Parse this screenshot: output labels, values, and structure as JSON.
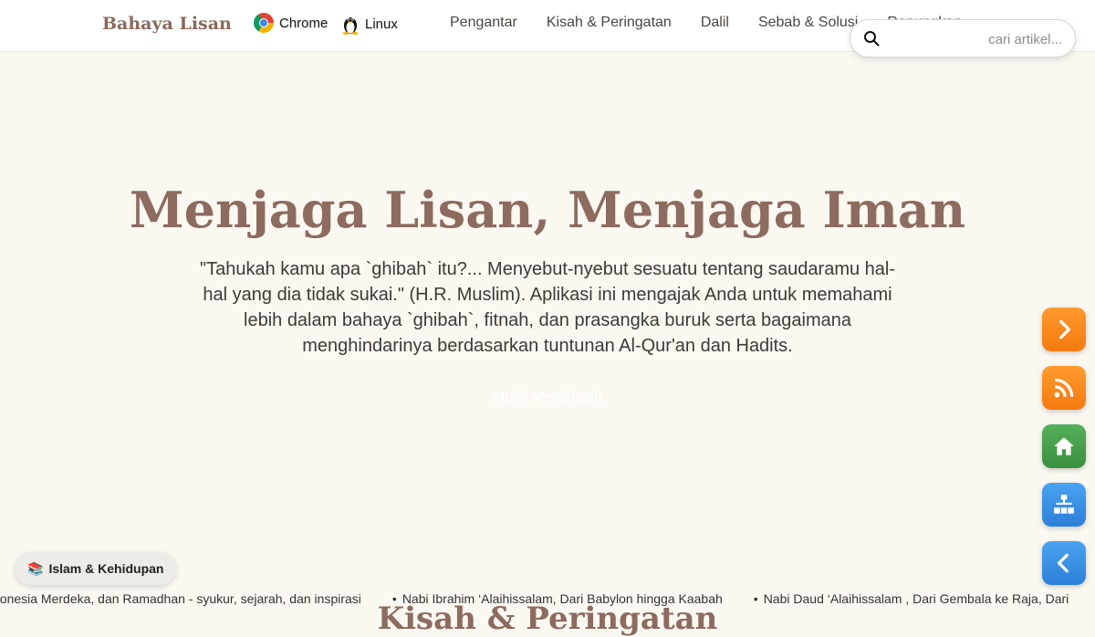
{
  "header": {
    "brand": "Bahaya Lisan",
    "env": {
      "browser": "Chrome",
      "os": "Linux"
    },
    "nav": [
      "Pengantar",
      "Kisah & Peringatan",
      "Dalil",
      "Sebab & Solusi",
      "Renungkan"
    ],
    "search": {
      "placeholder": "cari artikel...",
      "value": ""
    }
  },
  "hero": {
    "title": "Menjaga Lisan, Menjaga Iman",
    "text": "\"Tahukah kamu apa `ghibah` itu?... Menyebut-nyebut sesuatu tentang saudaramu hal-hal yang dia tidak sukai.\" (H.R. Muslim). Aplikasi ini mengajak Anda untuk memahami lebih dalam bahaya `ghibah`, fitnah, dan prasangka buruk serta bagaimana menghindarinya berdasarkan tuntunan Al-Qur'an dan Hadits.",
    "cta": "Mulai Menjelajah"
  },
  "section_peek": "Kisah & Peringatan",
  "ticker": [
    "donesia Merdeka, dan Ramadhan - syukur, sejarah, dan inspirasi",
    "Nabi Ibrahim ‘Alaihissalam, Dari Babylon hingga Kaabah",
    "Nabi Daud ‘Alaihissalam , Dari Gembala ke Raja, Dari"
  ],
  "category_pill": {
    "icon": "📚",
    "label": "Islam & Kehidupan"
  },
  "side_buttons": [
    {
      "icon": "chevron-right-icon",
      "color": "#f7861c"
    },
    {
      "icon": "rss-icon",
      "color": "#f7861c"
    },
    {
      "icon": "home-icon",
      "color": "#43a047"
    },
    {
      "icon": "sitemap-icon",
      "color": "#2e8be6"
    },
    {
      "icon": "chevron-left-icon",
      "color": "#2e8be6"
    }
  ]
}
